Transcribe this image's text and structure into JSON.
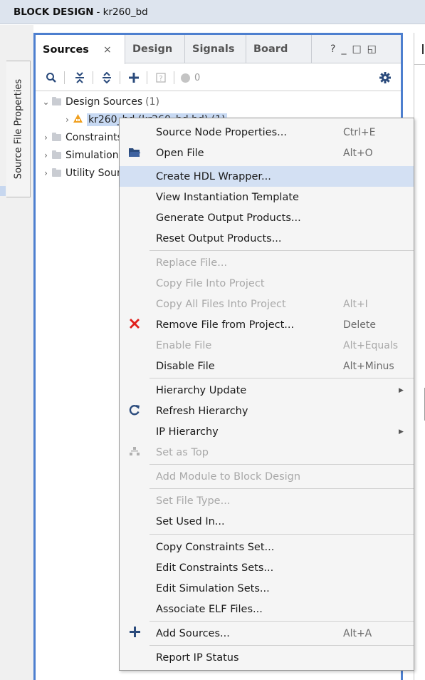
{
  "window": {
    "title_bold": "BLOCK DESIGN",
    "title_rest": "- kr260_bd"
  },
  "side_tab": {
    "label": "Source File Properties"
  },
  "tabs": [
    {
      "label": "Sources",
      "close": "×"
    },
    {
      "label": "Design"
    },
    {
      "label": "Signals"
    },
    {
      "label": "Board"
    }
  ],
  "window_controls": {
    "help": "?",
    "minimize": "_",
    "maximize": "□",
    "float": "◱"
  },
  "toolbar": {
    "status_count": "0"
  },
  "tree": {
    "design_sources": {
      "label": "Design Sources",
      "count": "(1)"
    },
    "bd_item": {
      "label": "kr260_bd (kr260_bd.bd) (1)"
    },
    "constraints": {
      "label": "Constraints"
    },
    "simulation": {
      "label": "Simulation Sources"
    },
    "utility": {
      "label": "Utility Sources"
    }
  },
  "context_menu": {
    "items": [
      {
        "label": "Source Node Properties...",
        "shortcut": "Ctrl+E",
        "icon": "",
        "enabled": true
      },
      {
        "label": "Open File",
        "shortcut": "Alt+O",
        "icon": "folder-open-icon",
        "enabled": true
      },
      {
        "label": "Create HDL Wrapper...",
        "shortcut": "",
        "icon": "",
        "enabled": true,
        "selected": true
      },
      {
        "label": "View Instantiation Template",
        "shortcut": "",
        "icon": "",
        "enabled": true
      },
      {
        "label": "Generate Output Products...",
        "shortcut": "",
        "icon": "",
        "enabled": true
      },
      {
        "label": "Reset Output Products...",
        "shortcut": "",
        "icon": "",
        "enabled": true
      },
      {
        "label": "Replace File...",
        "shortcut": "",
        "icon": "",
        "enabled": false
      },
      {
        "label": "Copy File Into Project",
        "shortcut": "",
        "icon": "",
        "enabled": false
      },
      {
        "label": "Copy All Files Into Project",
        "shortcut": "Alt+I",
        "icon": "",
        "enabled": false
      },
      {
        "label": "Remove File from Project...",
        "shortcut": "Delete",
        "icon": "red-x-icon",
        "enabled": true
      },
      {
        "label": "Enable File",
        "shortcut": "Alt+Equals",
        "icon": "",
        "enabled": false
      },
      {
        "label": "Disable File",
        "shortcut": "Alt+Minus",
        "icon": "",
        "enabled": true
      },
      {
        "label": "Hierarchy Update",
        "shortcut": "",
        "icon": "",
        "enabled": true,
        "submenu": true
      },
      {
        "label": "Refresh Hierarchy",
        "shortcut": "",
        "icon": "refresh-icon",
        "enabled": true
      },
      {
        "label": "IP Hierarchy",
        "shortcut": "",
        "icon": "",
        "enabled": true,
        "submenu": true
      },
      {
        "label": "Set as Top",
        "shortcut": "",
        "icon": "hierarchy-icon",
        "enabled": false
      },
      {
        "label": "Add Module to Block Design",
        "shortcut": "",
        "icon": "",
        "enabled": false
      },
      {
        "label": "Set File Type...",
        "shortcut": "",
        "icon": "",
        "enabled": false
      },
      {
        "label": "Set Used In...",
        "shortcut": "",
        "icon": "",
        "enabled": true
      },
      {
        "label": "Copy Constraints Set...",
        "shortcut": "",
        "icon": "",
        "enabled": true
      },
      {
        "label": "Edit Constraints Sets...",
        "shortcut": "",
        "icon": "",
        "enabled": true
      },
      {
        "label": "Edit Simulation Sets...",
        "shortcut": "",
        "icon": "",
        "enabled": true
      },
      {
        "label": "Associate ELF Files...",
        "shortcut": "",
        "icon": "",
        "enabled": true
      },
      {
        "label": "Add Sources...",
        "shortcut": "Alt+A",
        "icon": "plus-icon",
        "enabled": true
      },
      {
        "label": "Report IP Status",
        "shortcut": "",
        "icon": "",
        "enabled": true
      }
    ]
  },
  "colors": {
    "panel_border": "#4d7fcf",
    "selection": "#d3e0f3",
    "remove_icon": "#e0201c",
    "refresh_icon": "#2b4b7c"
  }
}
